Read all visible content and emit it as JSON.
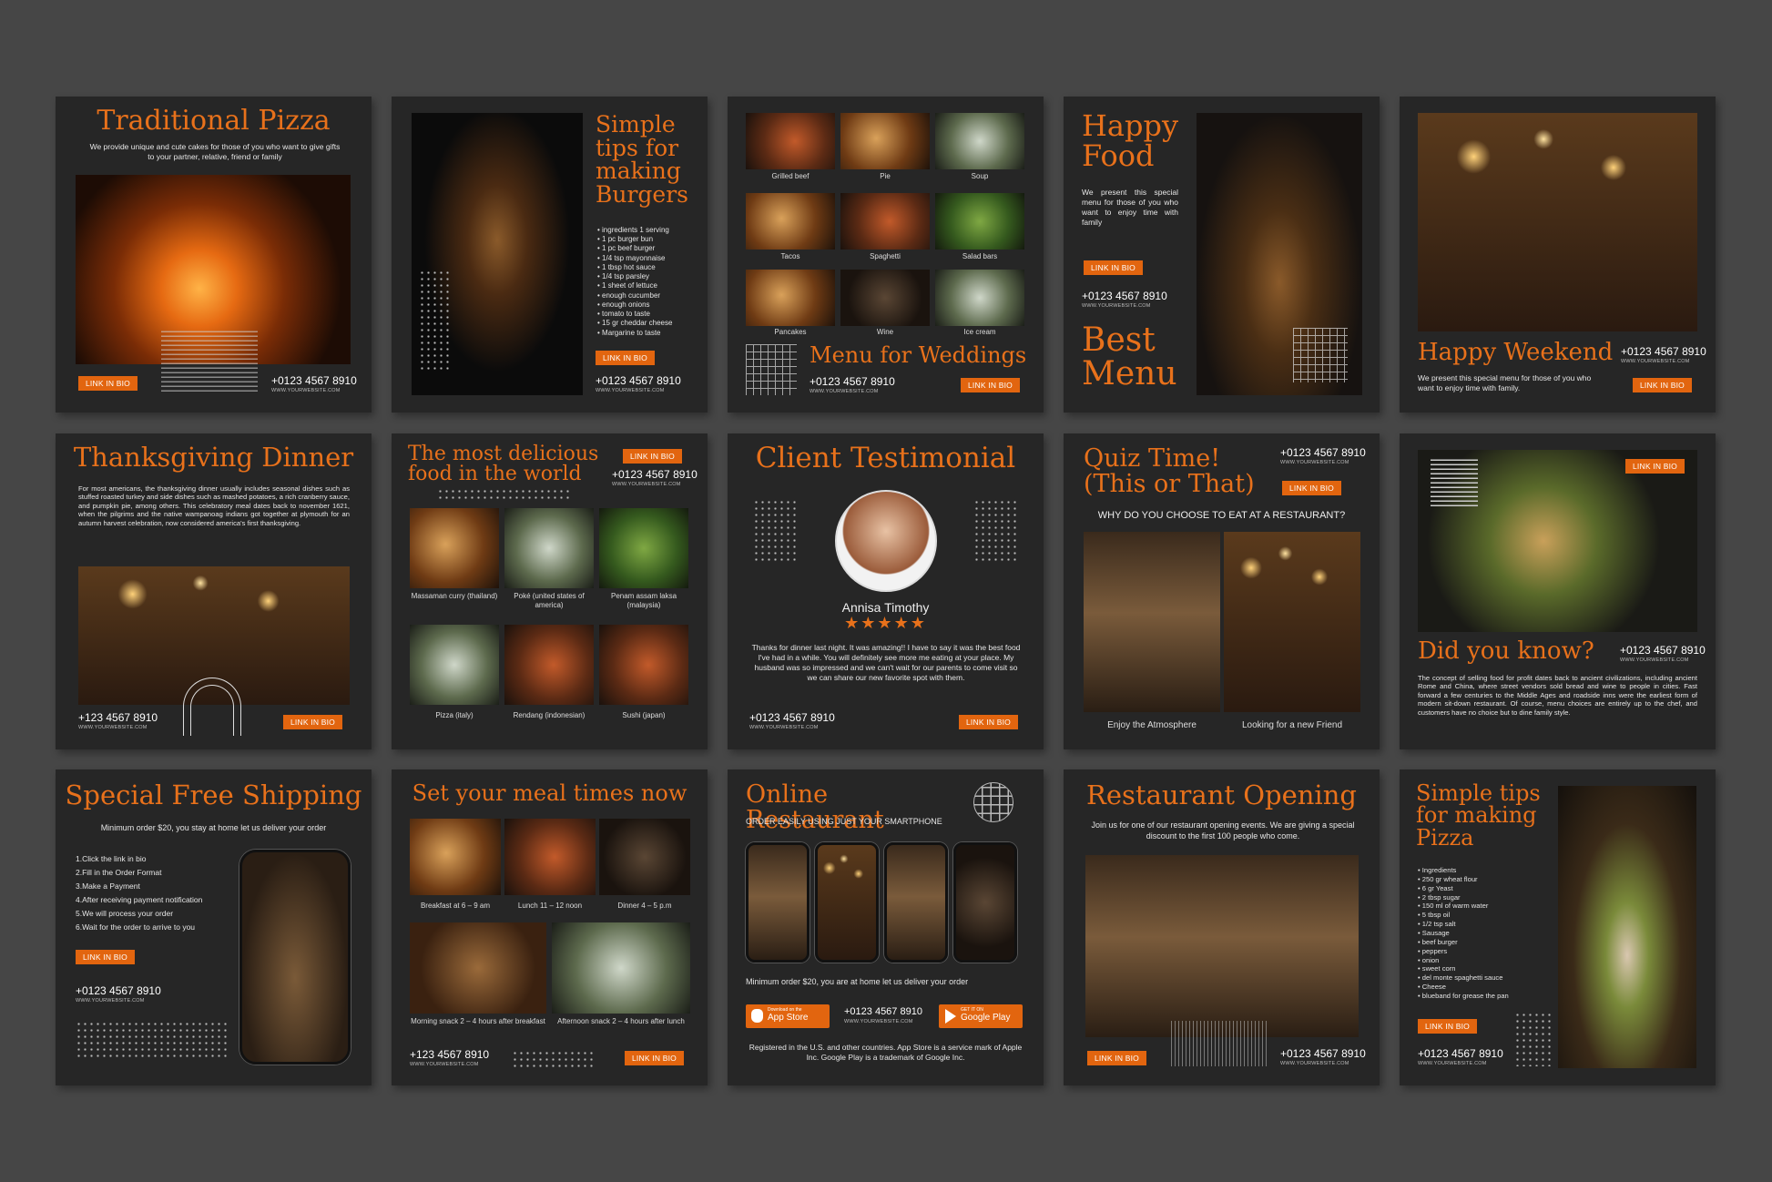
{
  "common": {
    "link": "LINK IN BIO",
    "web": "WWW.YOURWEBSITE.COM",
    "phone": "+0123 4567 8910",
    "phone_alt": "+123 4567 8910"
  },
  "c1": {
    "title": "Traditional Pizza",
    "text": "We provide unique and cute cakes for those of you who want to give gifts to your partner, relative, friend or family"
  },
  "c2": {
    "title": "Simple tips for making Burgers",
    "items": [
      "ingredients 1 serving",
      "1 pc burger bun",
      "1 pc beef burger",
      "1/4 tsp mayonnaise",
      "1 tbsp hot sauce",
      "1/4 tsp parsley",
      "1 sheet of lettuce",
      "enough cucumber",
      "enough onions",
      "tomato to taste",
      "15 gr cheddar cheese",
      "Margarine to taste"
    ]
  },
  "c3": {
    "title": "Menu for Weddings",
    "items": [
      "Grilled beef",
      "Pie",
      "Soup",
      "Tacos",
      "Spaghetti",
      "Salad bars",
      "Pancakes",
      "Wine",
      "Ice cream"
    ]
  },
  "c4": {
    "title1": "Happy Food",
    "text": "We present this special menu for those of you who want to enjoy time with family",
    "title2": "Best Menu"
  },
  "c5": {
    "title": "Happy Weekend",
    "text": "We present this special menu for those of you who want to enjoy time with family."
  },
  "c6": {
    "title": "Thanksgiving Dinner",
    "text": "For most americans, the thanksgiving dinner usually includes seasonal dishes such as stuffed roasted turkey and side dishes such as mashed potatoes, a rich cranberry sauce, and pumpkin pie, among others. This celebratory meal dates back to november 1621, when the pilgrims and the native wampanoag indians got together at plymouth for an autumn harvest celebration, now considered america's first thanksgiving."
  },
  "c7": {
    "title": "The most delicious food in the world",
    "items": [
      "Massaman curry (thailand)",
      "Poké (united states of america)",
      "Penam assam laksa (malaysia)",
      "Pizza (italy)",
      "Rendang (indonesian)",
      "Sushi (japan)"
    ]
  },
  "c8": {
    "title": "Client Testimonial",
    "name": "Annisa Timothy",
    "stars": "★★★★★",
    "text": "Thanks for dinner last night. It was amazing!! I have to say it was the best food I've had in a while. You will definitely see more me eating at your place. My husband was so impressed and we can't wait for our parents to come visit so we can share our new favorite spot with them."
  },
  "c9": {
    "title1": "Quiz Time!",
    "title2": "(This or That)",
    "question": "WHY DO YOU CHOOSE TO EAT AT A RESTAURANT?",
    "opt1": "Enjoy the Atmosphere",
    "opt2": "Looking for a new Friend"
  },
  "c10": {
    "title": "Did you know?",
    "text": "The concept of selling food for profit dates back to ancient civilizations, including ancient Rome and China, where street vendors sold bread and wine to people in cities. Fast forward a few centuries to the Middle Ages and roadside inns were the earliest form of modern sit-down restaurant. Of course, menu choices are entirely up to the chef, and customers have no choice but to dine family style."
  },
  "c11": {
    "title": "Special Free Shipping",
    "sub": "Minimum order $20, you stay at home let us deliver your order",
    "steps": [
      "1.Click the link in bio",
      "2.Fill in the Order Format",
      "3.Make a Payment",
      "4.After receiving payment notification",
      "5.We will process your order",
      "6.Wait for the order to arrive to you"
    ]
  },
  "c12": {
    "title": "Set your meal times now",
    "items": [
      "Breakfast at 6 – 9 am",
      "Lunch 11 – 12 noon",
      "Dinner 4 – 5 p.m",
      "Morning snack 2 – 4 hours after breakfast",
      "Afternoon snack 2 – 4 hours after lunch"
    ]
  },
  "c13": {
    "title": "Online Restaurant",
    "sub": "ORDER EASILY USING JUST YOUR SMARTPHONE",
    "min": "Minimum order $20, you are at home let us deliver your order",
    "appstore_small": "Download on the",
    "appstore": "App Store",
    "gplay_small": "GET IT ON",
    "gplay": "Google Play",
    "legal": "Registered in the U.S. and other countries. App Store is a service mark of Apple Inc. Google Play is a trademark of Google Inc."
  },
  "c14": {
    "title": "Restaurant Opening",
    "text": "Join us for one of our restaurant opening events. We are giving a special discount to the first 100 people who come."
  },
  "c15": {
    "title": "Simple tips for making Pizza",
    "items": [
      "Ingredients",
      "250 gr wheat flour",
      "6 gr Yeast",
      "2 tbsp sugar",
      "150 ml of warm water",
      "5 tbsp oil",
      "1/2 tsp salt",
      "Sausage",
      "beef burger",
      "peppers",
      "onion",
      "sweet corn",
      "del monte spaghetti sauce",
      "Cheese",
      "blueband for grease the pan"
    ]
  }
}
